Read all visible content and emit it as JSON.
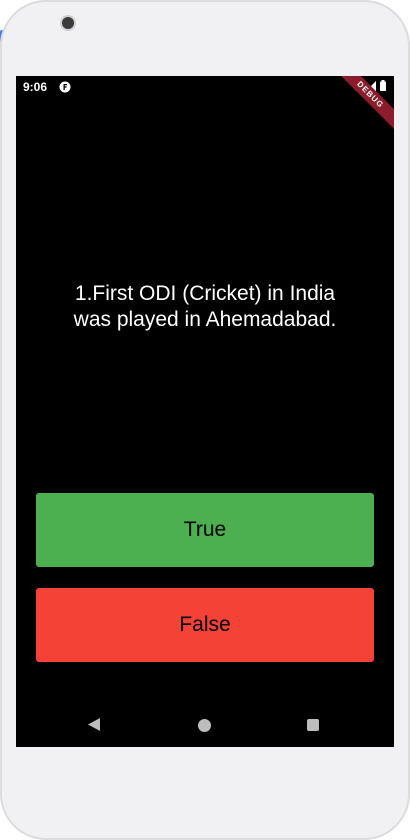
{
  "status_bar": {
    "time": "9:06",
    "app_icon": "flutter-f-icon",
    "icons": [
      "wifi-icon",
      "signal-icon",
      "battery-icon"
    ],
    "debug_banner": "DEBUG"
  },
  "quiz": {
    "question": "1.First ODI (Cricket) in India\nwas played in Ahemadabad.",
    "true_label": "True",
    "false_label": "False"
  },
  "colors": {
    "true_button": "#4caf50",
    "false_button": "#f44336",
    "screen_background": "#000000"
  },
  "nav_bar": {
    "icons": [
      "back-icon",
      "home-icon",
      "recents-icon"
    ]
  }
}
